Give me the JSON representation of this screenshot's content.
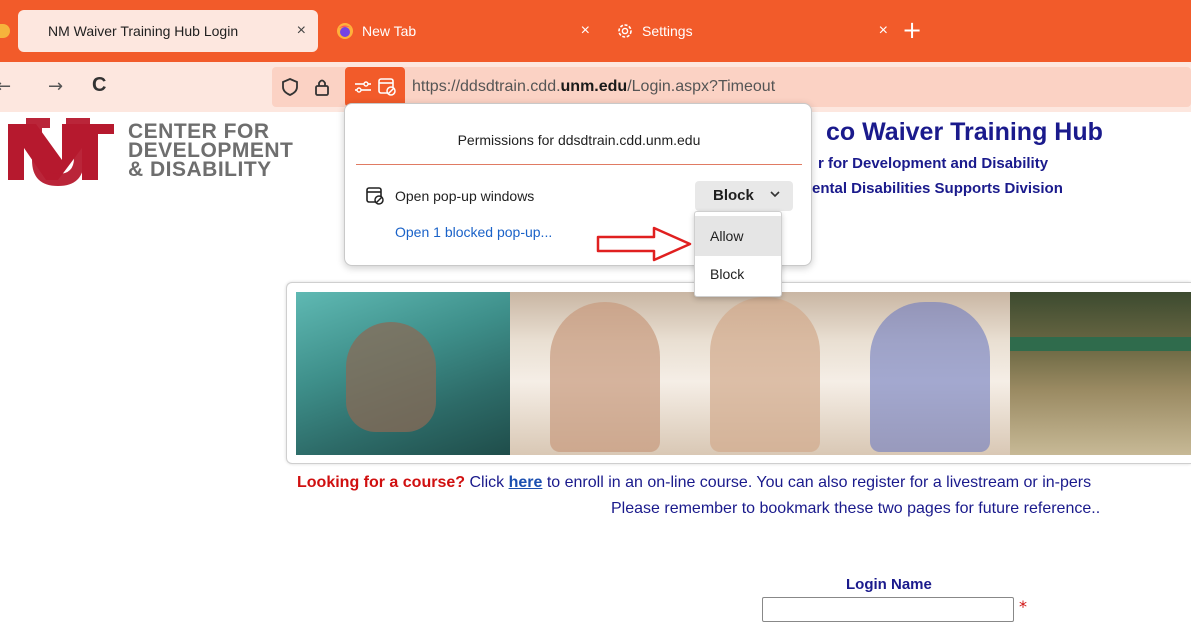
{
  "browser": {
    "tabs": [
      {
        "label": "NM Waiver Training Hub Login",
        "close": "×"
      },
      {
        "label": "New Tab",
        "close": "×"
      },
      {
        "label": "Settings",
        "close": "×"
      }
    ],
    "new_tab": "+",
    "nav": {
      "back": "←",
      "forward": "→",
      "reload": "C"
    },
    "url": {
      "prefix": "https://ddsdtrain.cdd.",
      "domain": "unm.edu",
      "suffix": "/Login.aspx?Timeout"
    },
    "accent_color": "#f25b2a"
  },
  "permissions_popup": {
    "title": "Permissions for ddsdtrain.cdd.unm.edu",
    "row_label": "Open pop-up windows",
    "selected_value": "Block",
    "options": [
      "Allow",
      "Block"
    ],
    "blocked_link": "Open 1 blocked pop-up..."
  },
  "page": {
    "logo_lines": [
      "CENTER FOR",
      "DEVELOPMENT",
      "& DISABILITY"
    ],
    "hub_title": "co Waiver Training Hub",
    "hub_sub1": "r for Development and Disability",
    "hub_sub2": "ental Disabilities Supports Division",
    "course_prompt": "Looking for a course?",
    "course_click": " Click ",
    "course_link": "here",
    "course_rest": " to enroll in an on-line course. You can also register for a livestream or in-pers",
    "remember": "Please remember to bookmark these two pages for future reference..",
    "login_label": "Login Name",
    "required_mark": "*"
  },
  "icons": {
    "shield": "shield-icon",
    "lock": "lock-icon",
    "permissions": "permissions-icon",
    "popup_blocked": "popup-blocked-icon",
    "gear": "gear-icon",
    "firefox": "firefox-icon"
  }
}
